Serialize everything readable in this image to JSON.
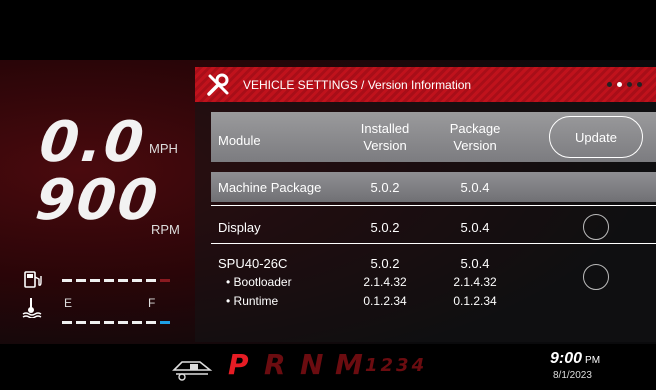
{
  "gauges": {
    "speed": "0.0",
    "speed_unit": "MPH",
    "rpm": "900",
    "rpm_unit": "RPM",
    "fuel_level": 0.8,
    "temp_label_left": "E",
    "temp_label_right": "F"
  },
  "panel": {
    "breadcrumb": "VEHICLE SETTINGS / Version Information",
    "page_dots": 3,
    "active_dot": 1
  },
  "table": {
    "headers": {
      "module": "Module",
      "installed": "Installed Version",
      "package": "Package Version"
    },
    "update_label": "Update",
    "rows": [
      {
        "module": "Machine Package",
        "installed": "5.0.2",
        "package": "5.0.4"
      },
      {
        "module": "Display",
        "installed": "5.0.2",
        "package": "5.0.4"
      },
      {
        "module": "SPU40-26C",
        "installed": "5.0.2",
        "package": "5.0.4",
        "subs": [
          {
            "name": "• Bootloader",
            "installed": "2.1.4.32",
            "package": "2.1.4.32"
          },
          {
            "name": "• Runtime",
            "installed": "0.1.2.34",
            "package": "0.1.2.34"
          }
        ]
      }
    ]
  },
  "footer": {
    "gears": {
      "p": "P",
      "r": "R",
      "n": "N",
      "m": "M",
      "numbers": "1234"
    },
    "time": "9:00",
    "ampm": "PM",
    "date": "8/1/2023"
  },
  "colors": {
    "accent": "#d0141e",
    "active_gear": "#e61c24",
    "inactive_gear": "#6b0c10",
    "temp_bar": "#1ea0e6"
  }
}
